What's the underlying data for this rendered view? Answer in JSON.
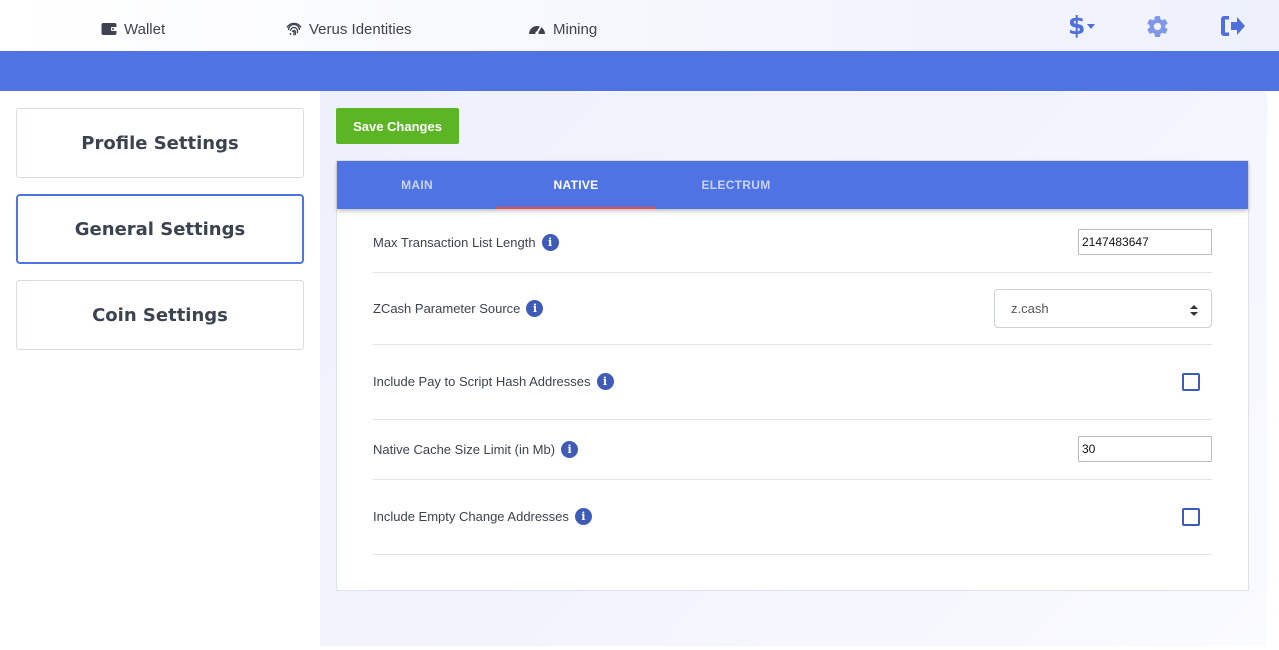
{
  "nav": {
    "wallet_label": "Wallet",
    "identities_label": "Verus Identities",
    "mining_label": "Mining",
    "currency_symbol": "$"
  },
  "sidebar": {
    "items": [
      {
        "label": "Profile Settings",
        "active": false
      },
      {
        "label": "General Settings",
        "active": true
      },
      {
        "label": "Coin Settings",
        "active": false
      }
    ]
  },
  "toolbar": {
    "save_label": "Save Changes"
  },
  "tabs": [
    {
      "label": "MAIN",
      "active": false
    },
    {
      "label": "NATIVE",
      "active": true
    },
    {
      "label": "ELECTRUM",
      "active": false
    }
  ],
  "settings": {
    "max_tx_list": {
      "label": "Max Transaction List Length",
      "value": "2147483647"
    },
    "zcash_param_source": {
      "label": "ZCash Parameter Source",
      "value": "z.cash"
    },
    "include_p2sh": {
      "label": "Include Pay to Script Hash Addresses",
      "checked": false
    },
    "native_cache_limit": {
      "label": "Native Cache Size Limit (in Mb)",
      "value": "30"
    },
    "include_empty_change": {
      "label": "Include Empty Change Addresses",
      "checked": false
    }
  },
  "colors": {
    "accent": "#4f73e2",
    "save_button": "#5cb524",
    "tab_indicator": "#e84b4b",
    "info_icon": "#3f5bb8"
  },
  "icons": {
    "wallet": "wallet-icon",
    "identities": "fingerprint-icon",
    "mining": "gauge-icon",
    "currency": "dollar-dropdown-icon",
    "settings": "gear-icon",
    "logout": "sign-out-icon",
    "info": "info-icon"
  }
}
